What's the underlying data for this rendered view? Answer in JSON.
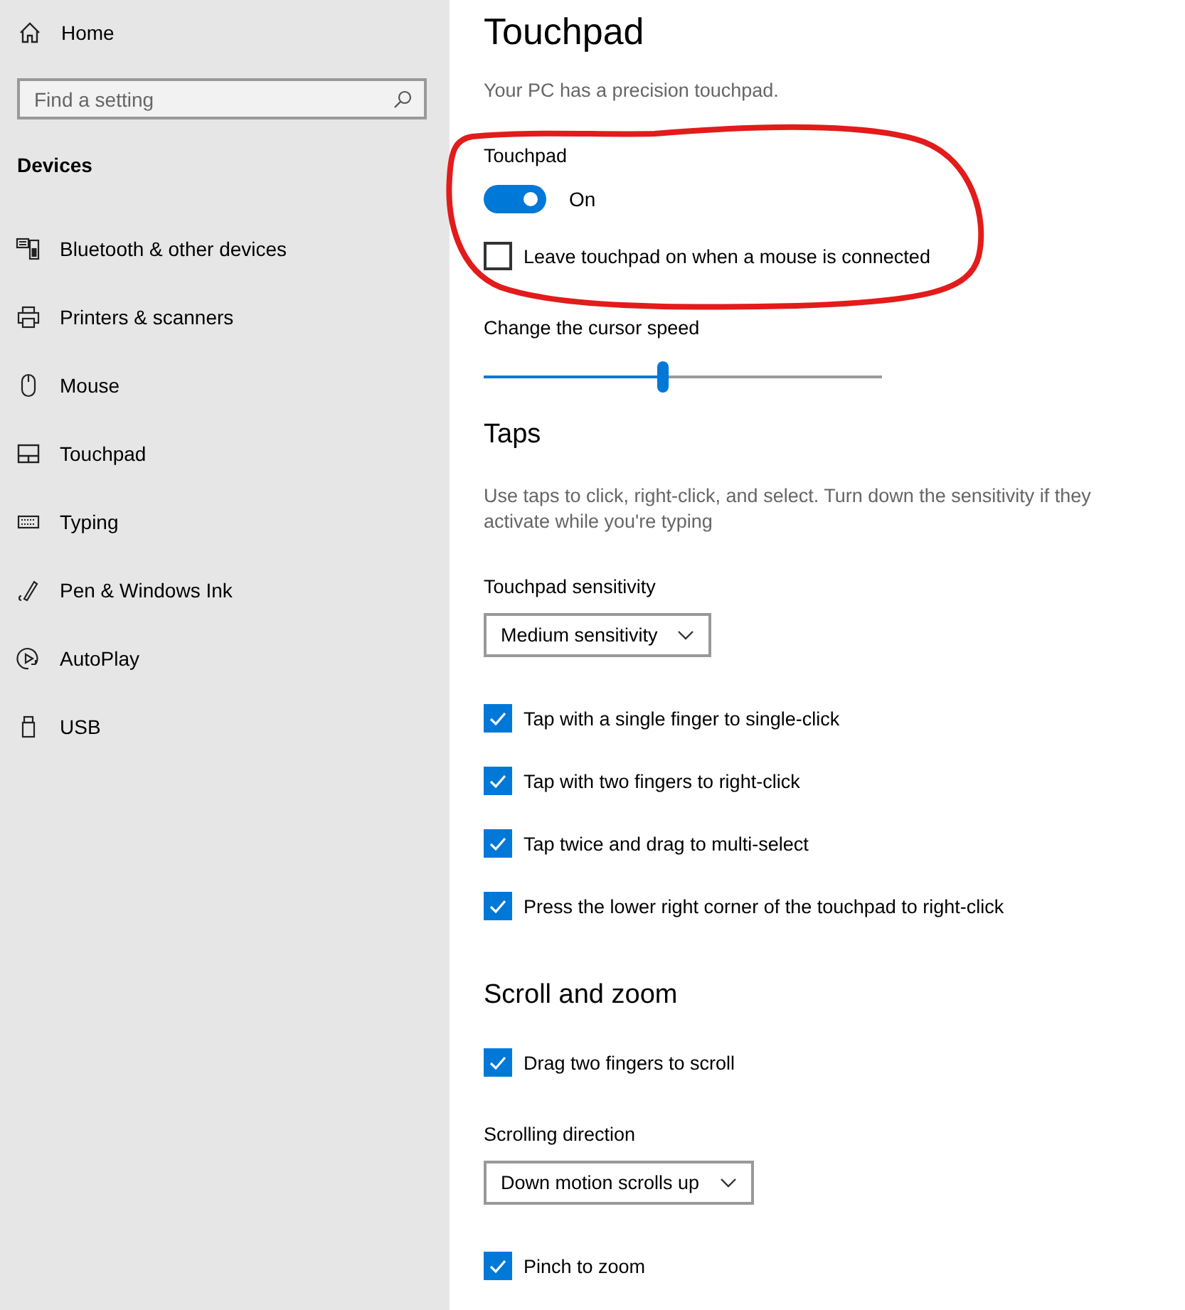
{
  "sidebar": {
    "home": "Home",
    "search": {
      "placeholder": "Find a setting"
    },
    "section": "Devices",
    "items": [
      {
        "label": "Bluetooth & other devices"
      },
      {
        "label": "Printers & scanners"
      },
      {
        "label": "Mouse"
      },
      {
        "label": "Touchpad"
      },
      {
        "label": "Typing"
      },
      {
        "label": "Pen & Windows Ink"
      },
      {
        "label": "AutoPlay"
      },
      {
        "label": "USB"
      }
    ]
  },
  "page": {
    "title": "Touchpad",
    "items": [
      {
        "kind": "paragraph",
        "text": "Your PC has a precision touchpad."
      },
      {
        "kind": "label",
        "text": "Touchpad"
      },
      {
        "kind": "toggle",
        "on": true,
        "text": "On"
      },
      {
        "kind": "checkbox",
        "checked": false,
        "text": "Leave touchpad on when a mouse is connected"
      },
      {
        "kind": "label",
        "text": "Change the cursor speed"
      },
      {
        "kind": "slider",
        "level": 0.45
      },
      {
        "kind": "heading",
        "text": "Taps"
      },
      {
        "kind": "paragraph",
        "text": "Use taps to click, right-click, and select. Turn down the sensitivity if they activate while you're typing"
      },
      {
        "kind": "label",
        "text": "Touchpad sensitivity"
      },
      {
        "kind": "dropdown",
        "text": "Medium sensitivity"
      },
      {
        "kind": "checkbox",
        "checked": true,
        "text": "Tap with a single finger to single-click"
      },
      {
        "kind": "checkbox",
        "checked": true,
        "text": "Tap with two fingers to right-click"
      },
      {
        "kind": "checkbox",
        "checked": true,
        "text": "Tap twice and drag to multi-select"
      },
      {
        "kind": "checkbox",
        "checked": true,
        "text": "Press the lower right corner of the touchpad to right-click"
      },
      {
        "kind": "heading",
        "text": "Scroll and zoom"
      },
      {
        "kind": "checkbox",
        "checked": true,
        "text": "Drag two fingers to scroll"
      },
      {
        "kind": "label",
        "text": "Scrolling direction"
      },
      {
        "kind": "dropdown",
        "text": "Down motion scrolls up"
      },
      {
        "kind": "checkbox",
        "checked": true,
        "text": "Pinch to zoom"
      }
    ]
  }
}
